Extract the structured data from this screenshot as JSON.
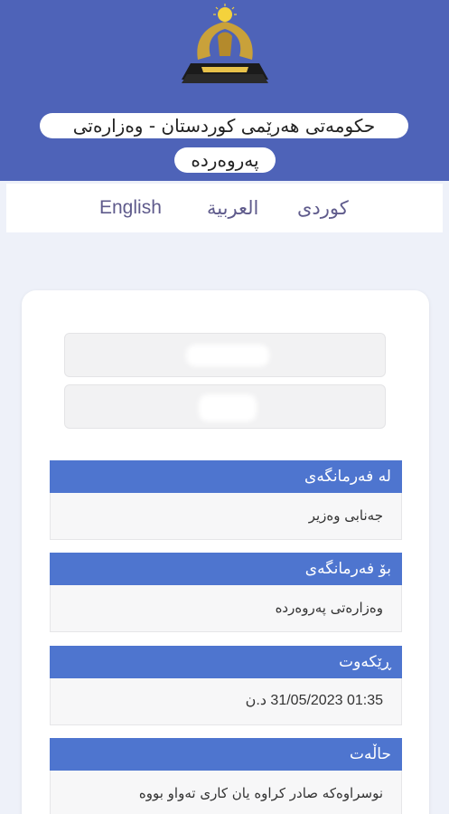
{
  "header": {
    "title_line1": "حکومەتی هەرێمی کوردستان - وەزارەتی",
    "title_line2": "پەروەردە",
    "colors": {
      "header_bg": "#4e63b8",
      "section_bg": "#4e75cf"
    },
    "logo_icon": "kurdistan-eagle-emblem"
  },
  "languages": [
    "English",
    "العربية",
    "کوردی"
  ],
  "sections": [
    {
      "label": "لە فەرمانگەی",
      "value": "جەنابی وەزیر"
    },
    {
      "label": "بۆ فەرمانگەی",
      "value": "وەزارەتی پەروەردە"
    },
    {
      "label": "ڕێکەوت",
      "value": "01:35 31/05/2023 د.ن"
    },
    {
      "label": "حاڵەت",
      "value": "نوسراوەکە صادر کراوە یان کاری تەواو بووە"
    }
  ]
}
